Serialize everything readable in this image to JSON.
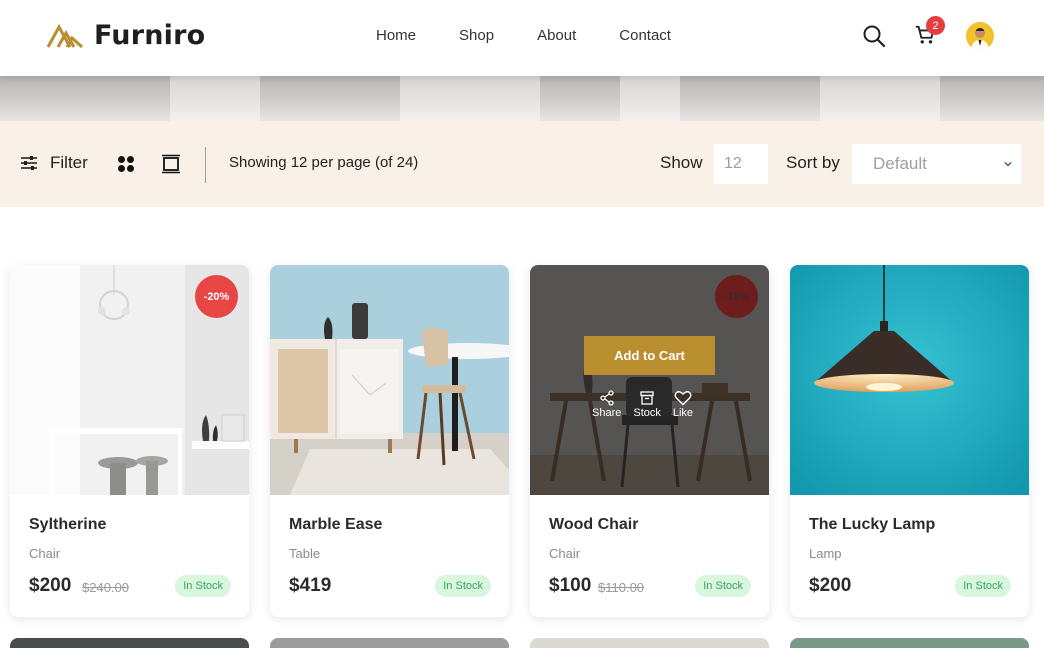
{
  "header": {
    "brand": "Furniro",
    "nav": [
      "Home",
      "Shop",
      "About",
      "Contact"
    ],
    "cart_count": "2",
    "icons": {
      "logo": "furniro-logo-icon",
      "search": "search-icon",
      "cart": "cart-icon",
      "user": "avatar"
    }
  },
  "filterbar": {
    "filter_label": "Filter",
    "showing_text": "Showing 12 per page (of 24)",
    "show_label": "Show",
    "show_value": "12",
    "sort_label": "Sort by",
    "sort_value": "Default"
  },
  "products": [
    {
      "name": "Syltherine",
      "category": "Chair",
      "price": "$200",
      "old_price": "$240.00",
      "stock": "In Stock",
      "badge": "-20%"
    },
    {
      "name": "Marble Ease",
      "category": "Table",
      "price": "$419",
      "old_price": "",
      "stock": "In Stock",
      "badge": ""
    },
    {
      "name": "Wood Chair",
      "category": "Chair",
      "price": "$100",
      "old_price": "$110.00",
      "stock": "In Stock",
      "badge": "-10%"
    },
    {
      "name": "The Lucky Lamp",
      "category": "Lamp",
      "price": "$200",
      "old_price": "",
      "stock": "In Stock",
      "badge": ""
    }
  ],
  "hover_overlay": {
    "add_to_cart": "Add to Cart",
    "share": "Share",
    "stock": "Stock",
    "like": "Like"
  },
  "colors": {
    "accent": "#b88e2f",
    "filter_bg": "#f9f1e7",
    "badge_red": "#e84545",
    "stock_green": "#3aa35a"
  }
}
